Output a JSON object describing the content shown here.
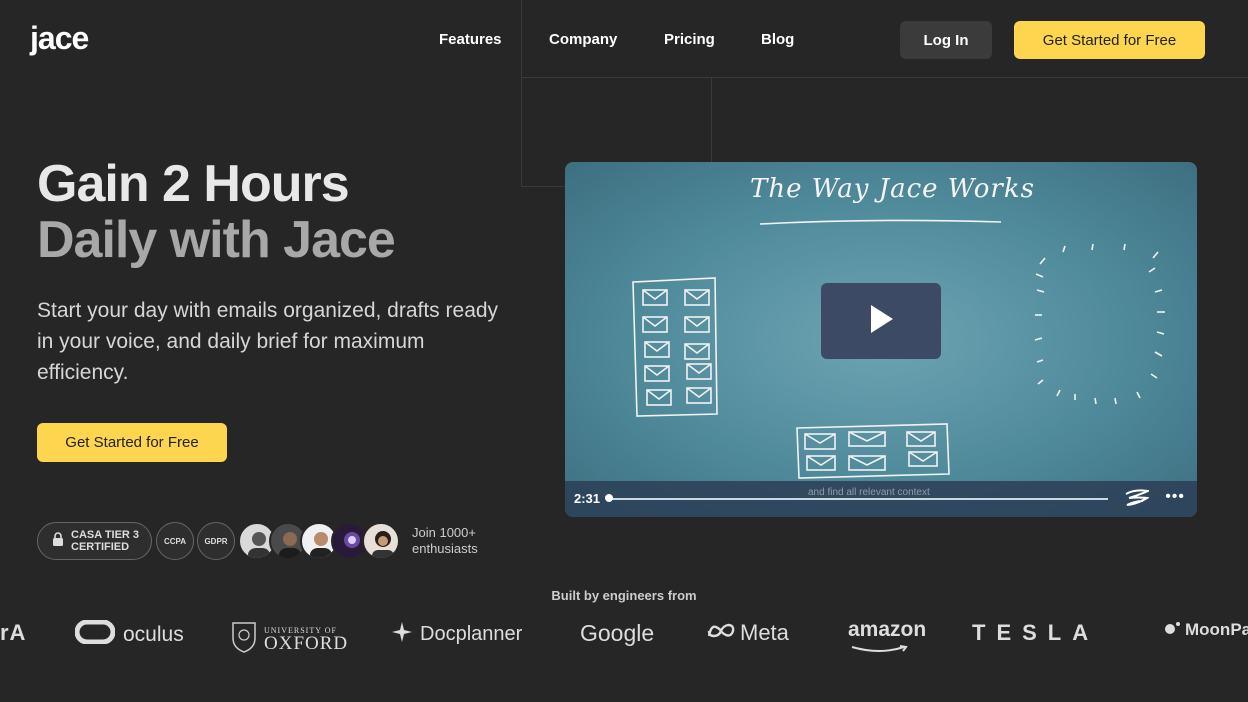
{
  "header": {
    "logo": "jace",
    "nav": [
      "Features",
      "Company",
      "Pricing",
      "Blog"
    ],
    "login_label": "Log In",
    "cta_label": "Get Started for Free"
  },
  "hero": {
    "title_line1": "Gain 2 Hours",
    "title_line2": "Daily with Jace",
    "subtitle": "Start your day with emails organized, drafts ready in your voice, and daily brief for maximum efficiency.",
    "cta_label": "Get Started for Free"
  },
  "badges": {
    "casa": "CASA TIER 3\nCERTIFIED",
    "ccpa": "CCPA",
    "gdpr": "GDPR",
    "join_line1": "Join 1000+",
    "join_line2": "enthusiasts"
  },
  "video": {
    "title": "The Way Jace Works",
    "time": "2:31",
    "caption": "and find all relevant context"
  },
  "built_by": {
    "label": "Built by engineers from",
    "companies": [
      "rA",
      "oculus",
      "UNIVERSITY OF",
      "OXFORD",
      "Docplanner",
      "Google",
      "Meta",
      "amazon",
      "TESLA",
      "MoonPa"
    ]
  },
  "colors": {
    "background": "#262626",
    "accent": "#fdd54f",
    "login_bg": "#3b3b3b",
    "video_bg": "#5b95a6"
  }
}
